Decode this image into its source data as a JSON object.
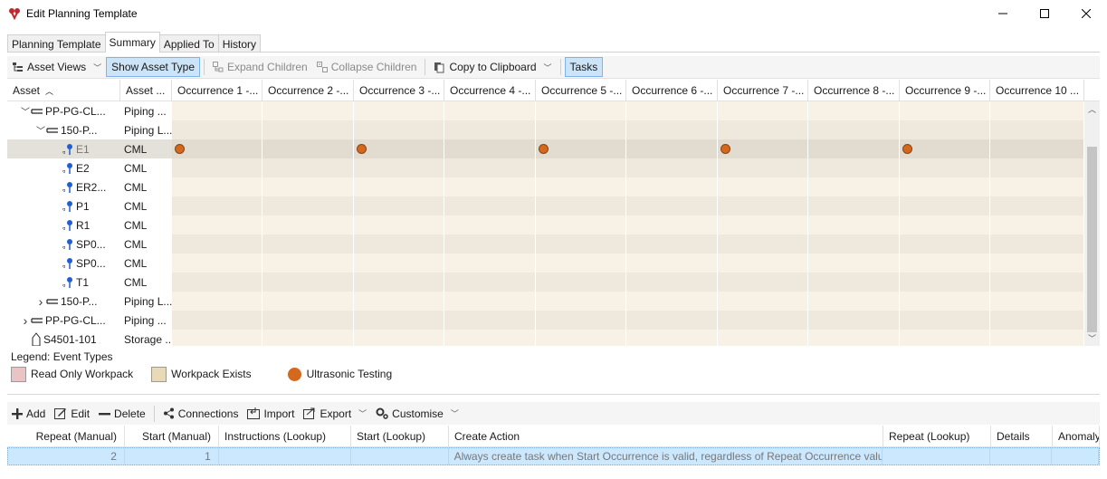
{
  "window": {
    "title": "Edit Planning Template",
    "icon": "app-logo-icon"
  },
  "tabs": [
    {
      "label": "Planning Template",
      "active": false
    },
    {
      "label": "Summary",
      "active": true
    },
    {
      "label": "Applied To",
      "active": false
    },
    {
      "label": "History",
      "active": false
    }
  ],
  "toolbar": {
    "asset_views": "Asset Views",
    "show_asset_type": "Show Asset Type",
    "expand_children": "Expand Children",
    "collapse_children": "Collapse Children",
    "copy_to_clipboard": "Copy to Clipboard",
    "tasks": "Tasks"
  },
  "grid": {
    "columns": {
      "asset": "Asset",
      "asset_type": "Asset ...",
      "occurrences": [
        "Occurrence 1 -...",
        "Occurrence 2 -...",
        "Occurrence 3 -...",
        "Occurrence 4 -...",
        "Occurrence 5 -...",
        "Occurrence 6 -...",
        "Occurrence 7 -...",
        "Occurrence 8 -...",
        "Occurrence 9 -...",
        "Occurrence 10 ..."
      ]
    },
    "rows": [
      {
        "asset": "PP-PG-CL...",
        "type": "Piping ...",
        "level": 1,
        "expander": "expanded",
        "icon": "pipe-icon",
        "dots": []
      },
      {
        "asset": "150-P...",
        "type": "Piping L...",
        "level": 2,
        "expander": "expanded",
        "icon": "pipe-icon",
        "dots": []
      },
      {
        "asset": "E1",
        "type": "CML",
        "level": 3,
        "expander": "none",
        "icon": "cml-point-icon",
        "selected": true,
        "dots": [
          1,
          3,
          5,
          7,
          9
        ]
      },
      {
        "asset": "E2",
        "type": "CML",
        "level": 3,
        "expander": "none",
        "icon": "cml-point-icon",
        "dots": []
      },
      {
        "asset": "ER2...",
        "type": "CML",
        "level": 3,
        "expander": "none",
        "icon": "cml-point-icon",
        "dots": []
      },
      {
        "asset": "P1",
        "type": "CML",
        "level": 3,
        "expander": "none",
        "icon": "cml-point-icon",
        "dots": []
      },
      {
        "asset": "R1",
        "type": "CML",
        "level": 3,
        "expander": "none",
        "icon": "cml-point-icon",
        "dots": []
      },
      {
        "asset": "SP0...",
        "type": "CML",
        "level": 3,
        "expander": "none",
        "icon": "cml-point-icon",
        "dots": []
      },
      {
        "asset": "SP0...",
        "type": "CML",
        "level": 3,
        "expander": "none",
        "icon": "cml-point-icon",
        "dots": []
      },
      {
        "asset": "T1",
        "type": "CML",
        "level": 3,
        "expander": "none",
        "icon": "cml-point-icon",
        "dots": []
      },
      {
        "asset": "150-P...",
        "type": "Piping L...",
        "level": 2,
        "expander": "collapsed",
        "icon": "pipe-icon",
        "dots": []
      },
      {
        "asset": "PP-PG-CL...",
        "type": "Piping ...",
        "level": 1,
        "expander": "collapsed",
        "icon": "pipe-icon",
        "dots": []
      },
      {
        "asset": "S4501-101",
        "type": "Storage ...",
        "level": 1,
        "expander": "none",
        "icon": "storage-tank-icon",
        "dots": []
      }
    ]
  },
  "legend": {
    "title": "Legend: Event Types",
    "items": [
      {
        "label": "Read Only Workpack",
        "color": "#e8c4c4"
      },
      {
        "label": "Workpack Exists",
        "color": "#e8d9b8"
      },
      {
        "label": "Ultrasonic Testing",
        "color": "#d2691e"
      }
    ]
  },
  "tasks_toolbar": {
    "add": "Add",
    "edit": "Edit",
    "delete": "Delete",
    "connections": "Connections",
    "import": "Import",
    "export": "Export",
    "customise": "Customise"
  },
  "tasks_table": {
    "columns": [
      "Repeat (Manual)",
      "Start (Manual)",
      "Instructions (Lookup)",
      "Start (Lookup)",
      "Create Action",
      "Repeat (Lookup)",
      "Details",
      "Anomaly"
    ],
    "rows": [
      [
        "2",
        "1",
        "",
        "",
        "Always create task when Start Occurrence is valid, regardless of Repeat Occurrence value.",
        "",
        "",
        ""
      ]
    ]
  },
  "colors": {
    "accent": "#cce4f7",
    "dot": "#d2691e",
    "occurrence_bg": "#f7f1e6"
  }
}
